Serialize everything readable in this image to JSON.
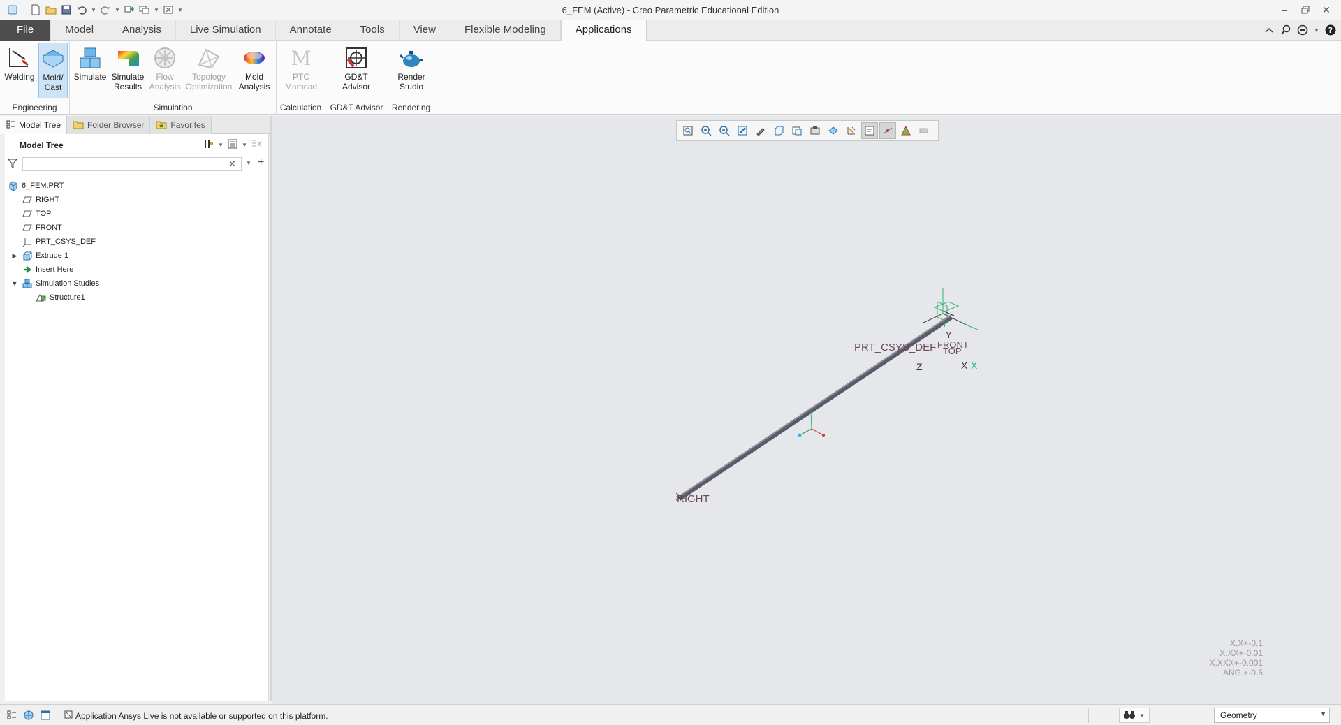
{
  "window": {
    "title": "6_FEM (Active) - Creo Parametric Educational Edition",
    "minimize_icon": "minimize-icon",
    "restore_icon": "restore-icon",
    "close_icon": "close-icon"
  },
  "tabs": [
    {
      "label": "File"
    },
    {
      "label": "Model"
    },
    {
      "label": "Analysis"
    },
    {
      "label": "Live Simulation"
    },
    {
      "label": "Annotate"
    },
    {
      "label": "Tools"
    },
    {
      "label": "View"
    },
    {
      "label": "Flexible Modeling"
    },
    {
      "label": "Applications"
    }
  ],
  "ribbon": {
    "groups": [
      {
        "label": "Engineering"
      },
      {
        "label": "Simulation"
      },
      {
        "label": "Calculation"
      },
      {
        "label": "GD&T Advisor"
      },
      {
        "label": "Rendering"
      }
    ],
    "buttons": [
      {
        "label": "Welding",
        "icon": "welding-icon"
      },
      {
        "label": "Mold/\nCast",
        "icon": "mold-cast-icon"
      },
      {
        "label": "Simulate",
        "icon": "simulate-icon"
      },
      {
        "label": "Simulate\nResults",
        "icon": "simulate-results-icon"
      },
      {
        "label": "Flow\nAnalysis",
        "icon": "flow-analysis-icon"
      },
      {
        "label": "Topology\nOptimization",
        "icon": "topology-optimization-icon"
      },
      {
        "label": "Mold\nAnalysis",
        "icon": "mold-analysis-icon"
      },
      {
        "label": "PTC\nMathcad",
        "icon": "ptc-mathcad-icon"
      },
      {
        "label": "GD&T\nAdvisor",
        "icon": "gdt-advisor-icon"
      },
      {
        "label": "Render\nStudio",
        "icon": "render-studio-icon"
      }
    ]
  },
  "navigator": {
    "tabs": [
      {
        "label": "Model Tree"
      },
      {
        "label": "Folder Browser"
      },
      {
        "label": "Favorites"
      }
    ],
    "tree_title": "Model Tree",
    "search": {
      "value": "",
      "placeholder": ""
    },
    "items": [
      {
        "label": "6_FEM.PRT",
        "icon": "part-icon"
      },
      {
        "label": "RIGHT",
        "icon": "datum-plane-icon"
      },
      {
        "label": "TOP",
        "icon": "datum-plane-icon"
      },
      {
        "label": "FRONT",
        "icon": "datum-plane-icon"
      },
      {
        "label": "PRT_CSYS_DEF",
        "icon": "csys-icon"
      },
      {
        "label": "Extrude 1",
        "icon": "extrude-icon",
        "expander": "collapsed"
      },
      {
        "label": "Insert Here",
        "icon": "insert-here-arrow-icon"
      },
      {
        "label": "Simulation Studies",
        "icon": "simulation-studies-icon",
        "expander": "expanded"
      },
      {
        "label": "Structure1",
        "icon": "structure-study-icon"
      }
    ]
  },
  "graphics": {
    "datum_labels": {
      "csys": "PRT_CSYS_DEF",
      "front": "FRONT",
      "top": "TOP",
      "right": "RIGHT",
      "axis_y": "Y",
      "axis_x": "X",
      "axis_z": "Z"
    },
    "tolerances": [
      "X.X+-0.1",
      "X.XX+-0.01",
      "X.XXX+-0.001",
      "ANG.+-0.5"
    ]
  },
  "status": {
    "message": "Application Ansys Live is not available or supported on this platform.",
    "selection_filter": "Geometry"
  },
  "colors": {
    "file_tab": "#4d4d4d",
    "graphics_bg": "#e6e7eb",
    "datum_label": "#6e4a55",
    "selected_button": "#cde4f7"
  }
}
